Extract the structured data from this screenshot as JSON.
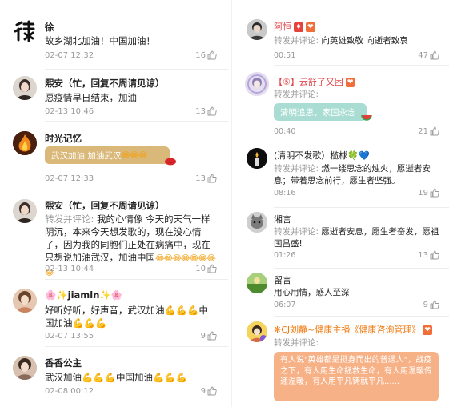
{
  "left": [
    {
      "name": "徐",
      "text": "故乡湖北加油！中国加油！",
      "time": "02-07 12:32",
      "likes": "16",
      "avatar": "calligraphy-avatar"
    },
    {
      "name": "熙安（忙，回复不周请见谅）",
      "text": "愿疫情早日结束，加油",
      "time": "02-13 10:46",
      "likes": "13",
      "avatar": "girl-avatar"
    },
    {
      "name": "时光记忆",
      "bubble": "武汉加油  加油武汉",
      "bubble_emojis": "😂😂😂",
      "time": "02-07 12:33",
      "likes": "13",
      "avatar": "flame-avatar"
    },
    {
      "name": "熙安（忙，回复不周请见谅）",
      "repost_label": "转发并评论: ",
      "text": "我的心情像 今天的天气一样阴沉，本来今天想发歌的，现在没心情了，因为我的同胞们正处在病痛中，现在只想说加油武汉，加油中国",
      "text_emojis": "😂😂😂😂😂😂😂😂",
      "time": "02-13 10:44",
      "likes": "10",
      "avatar": "girl-avatar"
    },
    {
      "name": "jiamln",
      "name_prefix": "🌸✨",
      "name_suffix": "✨🌸",
      "text": "好听好听，好声音，武汉加油💪💪💪中国加油💪💪💪",
      "time": "02-07 13:55",
      "likes": "9",
      "avatar": "woman-avatar"
    },
    {
      "name": "香香公主",
      "text": "武汉加油💪💪💪中国加油💪💪💪",
      "time": "02-08 00:12",
      "likes": "9",
      "avatar": "woman-avatar-2"
    }
  ],
  "right": [
    {
      "name": "阿恒",
      "repost_label": "转发并评论: ",
      "text": "向英雄致敬 向逝者致哀",
      "time": "00:51",
      "likes": "47",
      "avatar": "man-avatar"
    },
    {
      "name": "【⑤】云舒了又困",
      "repost_label": "转发并评论:",
      "bubble": "清明追思，家国永念",
      "time": "00:40",
      "likes": "21",
      "avatar": "anime-avatar"
    },
    {
      "name": "(清明不发歌）榄梂🍀💙",
      "repost_label": "转发并评论: ",
      "text": "燃一缕思念的烛火，愿逝者安息；带着思念前行，愿生者坚强。",
      "time": "08:16",
      "likes": "19",
      "avatar": "candle-avatar"
    },
    {
      "name": "湘言",
      "repost_label": "转发并评论: ",
      "text": "愿逝者安息，愿生者奋发，愿祖国昌盛!",
      "time": "01:26",
      "likes": "13",
      "avatar": "cat-avatar"
    },
    {
      "name": "留言",
      "text": "用心用情，感人至深",
      "time": "06:07",
      "likes": "9",
      "avatar": "landscape-avatar"
    },
    {
      "name": "CJ刘静~健康主播《健康咨询管理》",
      "name_prefix": "❋",
      "repost_label": "转发并评论:",
      "bubble_text": "有人说\"英雄都是挺身而出的普通人\"，战疫之下，有人用生命拯救生命，有人用温暖传递温暖，有人用平凡铸就平凡......",
      "avatar": "host-avatar"
    }
  ],
  "colors": {
    "bubble_gold": "#d9b879",
    "bubble_teal": "#a9dcd2",
    "bubble_orange": "#f7b187",
    "name_red": "#e0444a",
    "name_orange": "#f07a12"
  }
}
